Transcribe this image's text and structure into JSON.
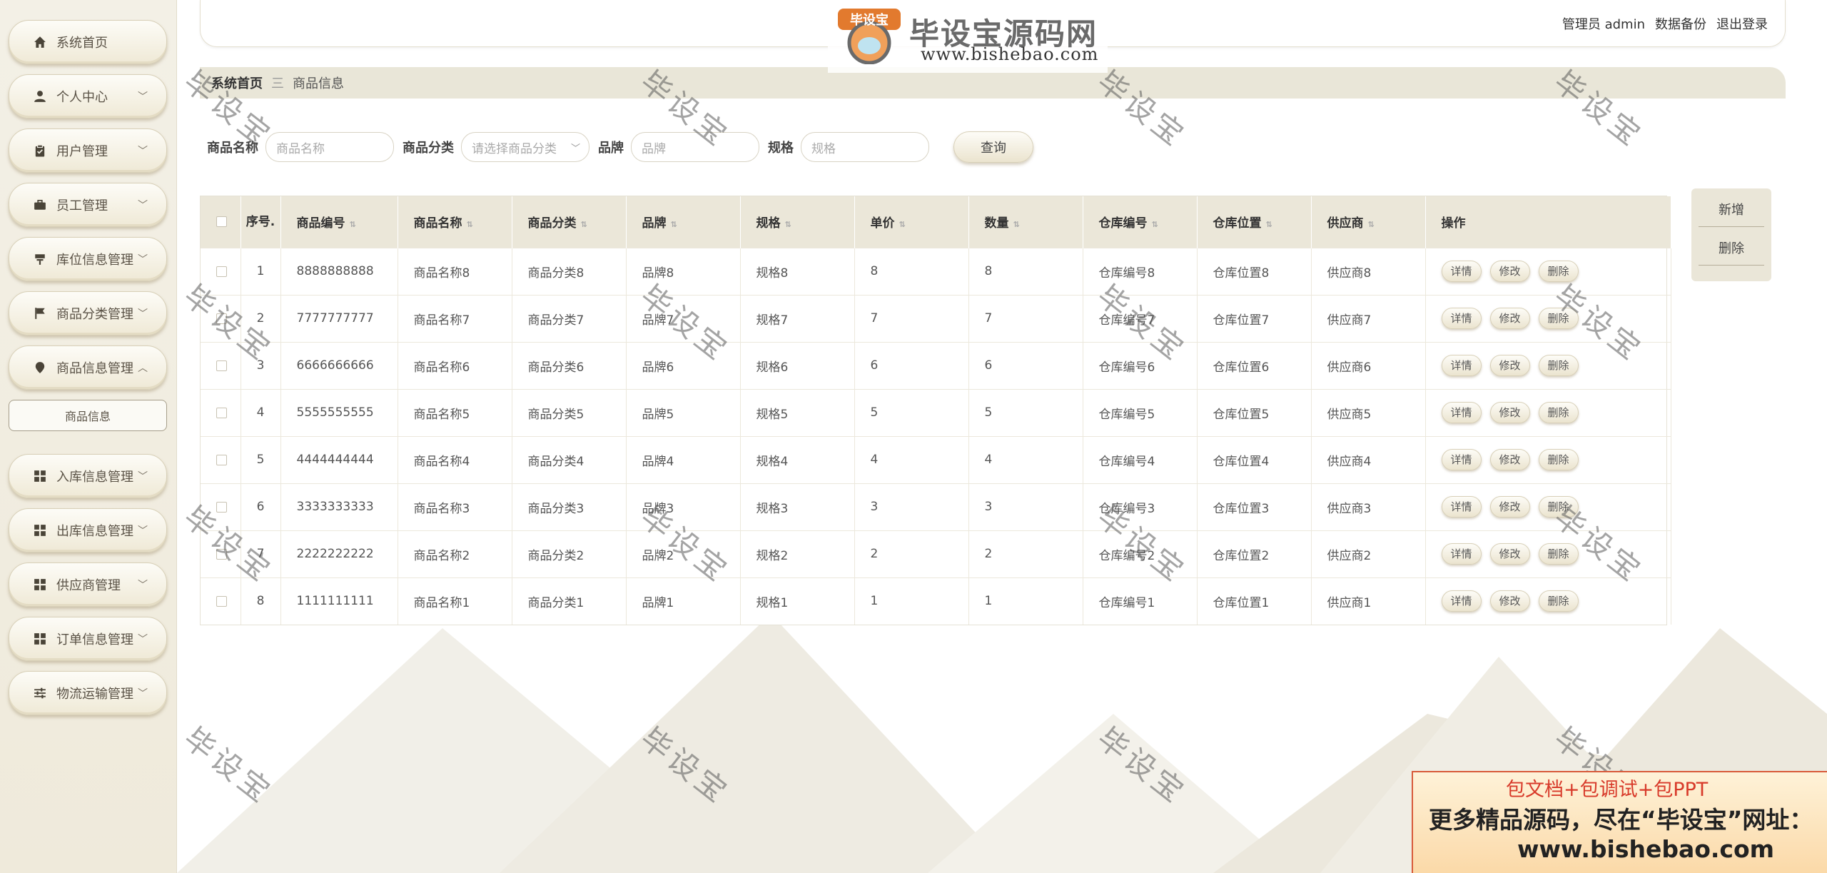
{
  "logo": {
    "badge_text": "毕设宝",
    "title": "毕设宝源码网",
    "url": "www.bishebao.com"
  },
  "header": {
    "user": "管理员 admin",
    "backup": "数据备份",
    "logout": "退出登录"
  },
  "sidebar": {
    "items": [
      {
        "label": "系统首页",
        "icon": "home-icon",
        "chevron": false
      },
      {
        "label": "个人中心",
        "icon": "person-icon",
        "chevron": true
      },
      {
        "label": "用户管理",
        "icon": "clipboard-icon",
        "chevron": true
      },
      {
        "label": "员工管理",
        "icon": "briefcase-icon",
        "chevron": true
      },
      {
        "label": "库位信息管理",
        "icon": "shelf-icon",
        "chevron": true
      },
      {
        "label": "商品分类管理",
        "icon": "flag-icon",
        "chevron": true
      },
      {
        "label": "商品信息管理",
        "icon": "location-icon",
        "chevron": true,
        "expanded": true
      },
      {
        "label": "入库信息管理",
        "icon": "grid-icon",
        "chevron": true
      },
      {
        "label": "出库信息管理",
        "icon": "grid-icon",
        "chevron": true
      },
      {
        "label": "供应商管理",
        "icon": "grid-icon",
        "chevron": true
      },
      {
        "label": "订单信息管理",
        "icon": "grid-icon",
        "chevron": true
      },
      {
        "label": "物流运输管理",
        "icon": "sliders-icon",
        "chevron": true
      }
    ],
    "submenu": "商品信息"
  },
  "breadcrumb": {
    "home": "系统首页",
    "separator": "三",
    "current": "商品信息"
  },
  "search": {
    "name_label": "商品名称",
    "name_placeholder": "商品名称",
    "category_label": "商品分类",
    "category_placeholder": "请选择商品分类",
    "brand_label": "品牌",
    "brand_placeholder": "品牌",
    "spec_label": "规格",
    "spec_placeholder": "规格",
    "button": "查询"
  },
  "actions": {
    "add": "新增",
    "delete": "删除"
  },
  "table": {
    "headers": {
      "index": "序号.",
      "code": "商品编号",
      "name": "商品名称",
      "category": "商品分类",
      "brand": "品牌",
      "spec": "规格",
      "price": "单价",
      "qty": "数量",
      "wh_code": "仓库编号",
      "wh_loc": "仓库位置",
      "supplier": "供应商",
      "ops": "操作"
    },
    "op_labels": {
      "detail": "详情",
      "edit": "修改",
      "delete": "删除"
    },
    "rows": [
      {
        "index": "1",
        "code": "8888888888",
        "name": "商品名称8",
        "category": "商品分类8",
        "brand": "品牌8",
        "spec": "规格8",
        "price": "8",
        "qty": "8",
        "wh_code": "仓库编号8",
        "wh_loc": "仓库位置8",
        "supplier": "供应商8"
      },
      {
        "index": "2",
        "code": "7777777777",
        "name": "商品名称7",
        "category": "商品分类7",
        "brand": "品牌7",
        "spec": "规格7",
        "price": "7",
        "qty": "7",
        "wh_code": "仓库编号7",
        "wh_loc": "仓库位置7",
        "supplier": "供应商7"
      },
      {
        "index": "3",
        "code": "6666666666",
        "name": "商品名称6",
        "category": "商品分类6",
        "brand": "品牌6",
        "spec": "规格6",
        "price": "6",
        "qty": "6",
        "wh_code": "仓库编号6",
        "wh_loc": "仓库位置6",
        "supplier": "供应商6"
      },
      {
        "index": "4",
        "code": "5555555555",
        "name": "商品名称5",
        "category": "商品分类5",
        "brand": "品牌5",
        "spec": "规格5",
        "price": "5",
        "qty": "5",
        "wh_code": "仓库编号5",
        "wh_loc": "仓库位置5",
        "supplier": "供应商5"
      },
      {
        "index": "5",
        "code": "4444444444",
        "name": "商品名称4",
        "category": "商品分类4",
        "brand": "品牌4",
        "spec": "规格4",
        "price": "4",
        "qty": "4",
        "wh_code": "仓库编号4",
        "wh_loc": "仓库位置4",
        "supplier": "供应商4"
      },
      {
        "index": "6",
        "code": "3333333333",
        "name": "商品名称3",
        "category": "商品分类3",
        "brand": "品牌3",
        "spec": "规格3",
        "price": "3",
        "qty": "3",
        "wh_code": "仓库编号3",
        "wh_loc": "仓库位置3",
        "supplier": "供应商3"
      },
      {
        "index": "7",
        "code": "2222222222",
        "name": "商品名称2",
        "category": "商品分类2",
        "brand": "品牌2",
        "spec": "规格2",
        "price": "2",
        "qty": "2",
        "wh_code": "仓库编号2",
        "wh_loc": "仓库位置2",
        "supplier": "供应商2"
      },
      {
        "index": "8",
        "code": "1111111111",
        "name": "商品名称1",
        "category": "商品分类1",
        "brand": "品牌1",
        "spec": "规格1",
        "price": "1",
        "qty": "1",
        "wh_code": "仓库编号1",
        "wh_loc": "仓库位置1",
        "supplier": "供应商1"
      }
    ]
  },
  "watermark": "毕设宝",
  "promo": {
    "line1": "包文档+包调试+包PPT",
    "line2": "更多精品源码，尽在“毕设宝”网址：",
    "line3": "www.bishebao.com"
  },
  "colors": {
    "accent": "#ebe7d9",
    "sidebar_bg": "#f3f0e6",
    "promo_red": "#d83a2a"
  }
}
